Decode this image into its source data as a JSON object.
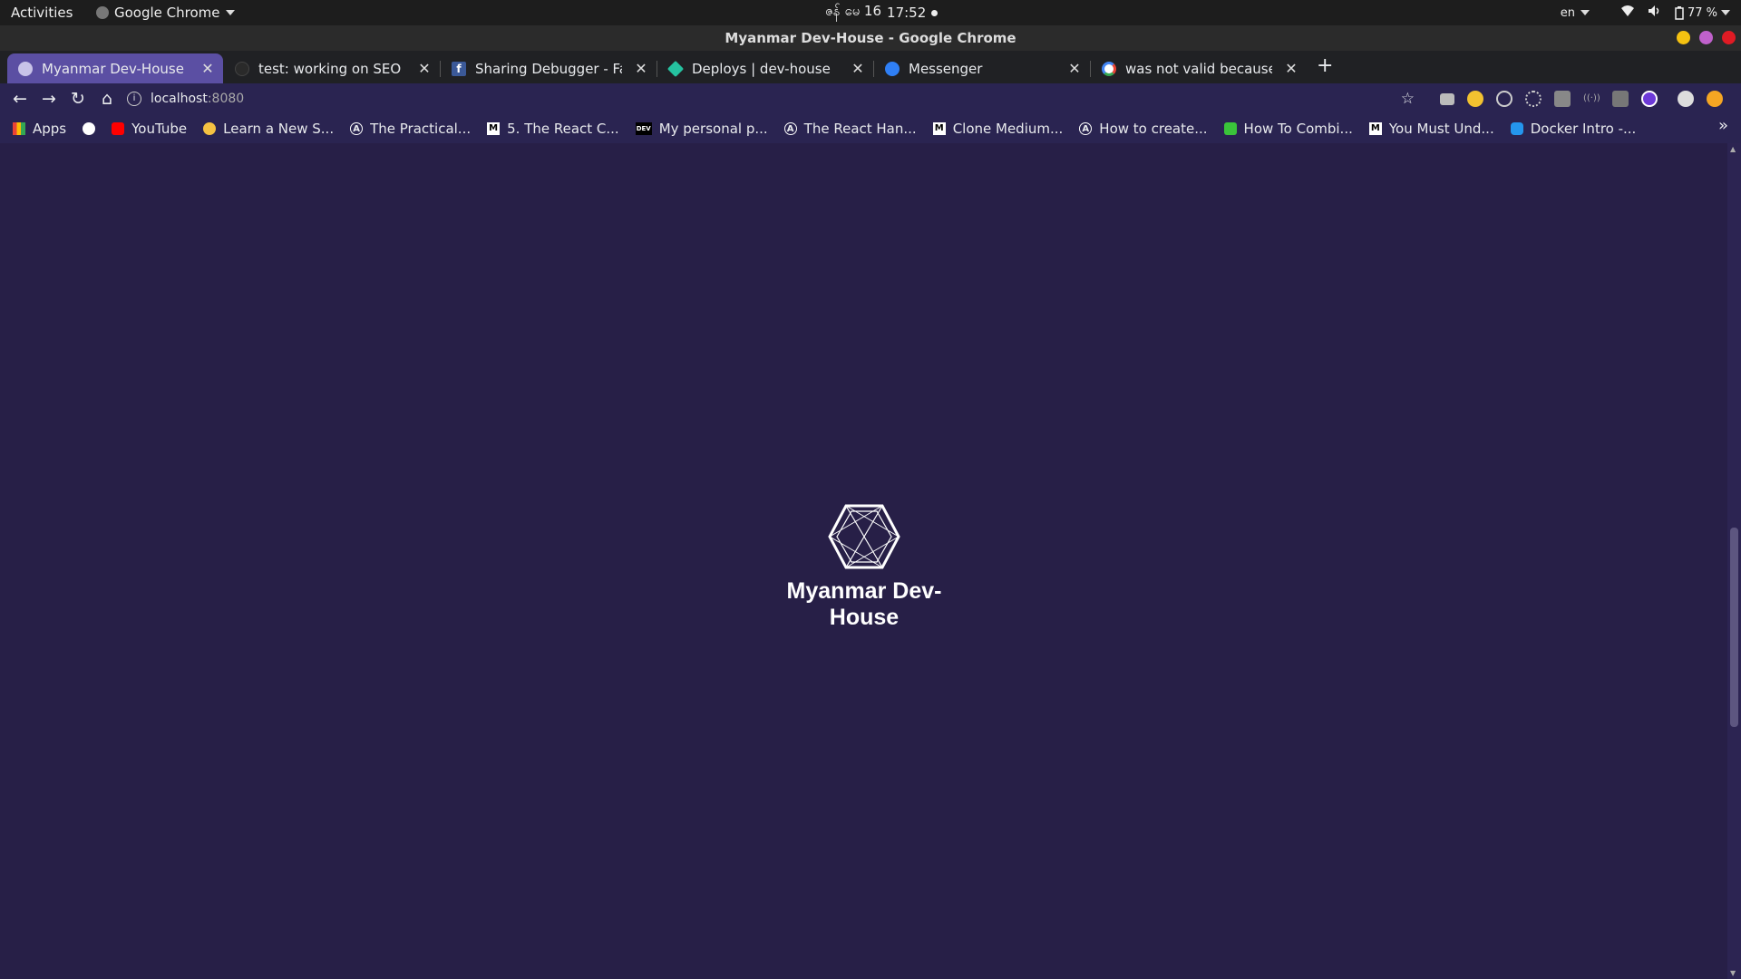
{
  "system": {
    "activities": "Activities",
    "app_name": "Google Chrome",
    "date": "ဇန် မေ 16",
    "time": "17:52",
    "language": "en",
    "battery": "77 %"
  },
  "window": {
    "title": "Myanmar Dev-House - Google Chrome",
    "controls": [
      "#f5c211",
      "#c061cb",
      "#e01b24"
    ]
  },
  "tabs": [
    {
      "label": "Myanmar Dev-House",
      "active": true,
      "icon": "globe-icon"
    },
    {
      "label": "test: working on SEO · nay",
      "active": false,
      "icon": "github-icon"
    },
    {
      "label": "Sharing Debugger - Faceb",
      "active": false,
      "icon": "facebook-icon"
    },
    {
      "label": "Deploys | dev-house",
      "active": false,
      "icon": "netlify-icon"
    },
    {
      "label": "Messenger",
      "active": false,
      "icon": "messenger-icon"
    },
    {
      "label": "was not valid because it d",
      "active": false,
      "icon": "google-icon"
    }
  ],
  "toolbar": {
    "url_host": "localhost",
    "url_port": ":8080"
  },
  "bookmarks": [
    {
      "label": "Apps",
      "icon": "apps-grid-icon"
    },
    {
      "label": "",
      "icon": "globe-icon"
    },
    {
      "label": "YouTube",
      "icon": "youtube-icon"
    },
    {
      "label": "Learn a New S...",
      "icon": "bookmark-site-icon"
    },
    {
      "label": "The Practical...",
      "icon": "bookmark-a-icon"
    },
    {
      "label": "5. The React C...",
      "icon": "medium-icon"
    },
    {
      "label": "My personal p...",
      "icon": "dev-icon"
    },
    {
      "label": "The React Han...",
      "icon": "bookmark-a-icon"
    },
    {
      "label": "Clone Medium...",
      "icon": "medium-icon"
    },
    {
      "label": "How to create...",
      "icon": "bookmark-a-icon"
    },
    {
      "label": "How To Combi...",
      "icon": "bookmark-green-icon"
    },
    {
      "label": "You Must Und...",
      "icon": "medium-icon"
    },
    {
      "label": "Docker Intro -...",
      "icon": "docker-icon"
    }
  ],
  "page": {
    "brand": "Myanmar Dev-House",
    "background": "#271f47"
  }
}
